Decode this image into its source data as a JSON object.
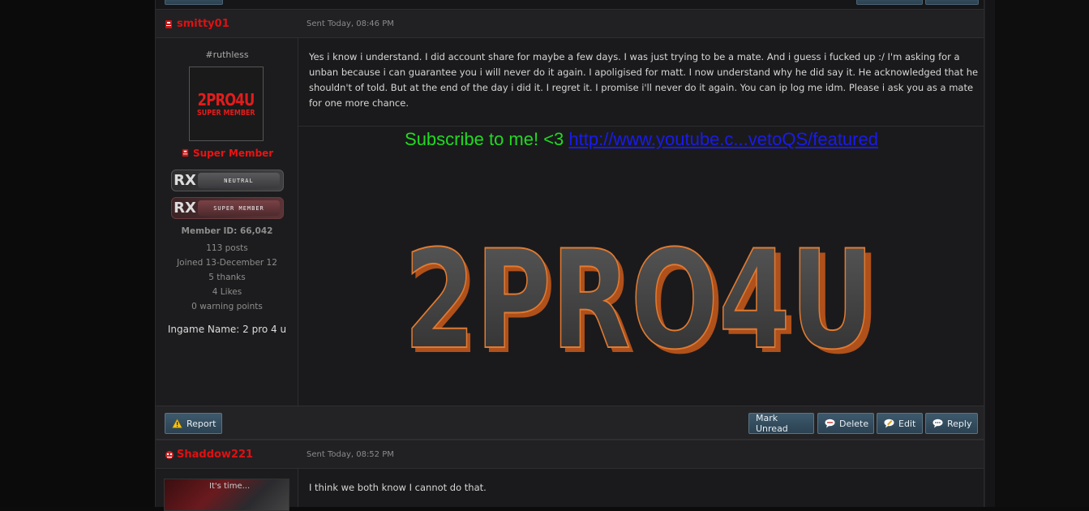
{
  "posts": [
    {
      "author": "smitty01",
      "sent": "Sent Today, 08:46 PM",
      "user_title": "#ruthless",
      "avatar_text": "2PRO4U",
      "avatar_subtext": "SUPER MEMBER",
      "group": "Super Member",
      "ranks": [
        {
          "tag": "RX",
          "label": "NEUTRAL"
        },
        {
          "tag": "RX",
          "label": "SUPER MEMBER"
        }
      ],
      "member_id": "Member ID: 66,042",
      "stats": [
        "113 posts",
        "Joined 13-December 12",
        "5 thanks",
        "4 Likes",
        "0 warning points"
      ],
      "ingame": "Ingame Name: 2 pro 4 u",
      "message": "Yes i know i understand. I did account share for maybe a few days. I was just trying to be a mate. And i guess i fucked up :/ I'm asking for a unban because i can guarantee you i will never do it again. I apoligised for matt. I now understand why he did say it. He acknowledged that he shouldn't of told. But at the end of the day i did it. I regret it. I promise i'll never do it again. You can ip log me idm. Please i ask you as a mate for one more chance.",
      "signature": {
        "text": "Subscribe to me! <3",
        "link": "http://www.youtube.c...vetoQS/featured",
        "banner_text": "2PRO4U"
      }
    },
    {
      "author": "Shaddow221",
      "sent": "Sent Today, 08:52 PM",
      "avatar_caption": "It's time...",
      "message": "I think we both know I cannot do that."
    }
  ],
  "buttons": {
    "report": "Report",
    "mark_unread": "Mark Unread",
    "delete": "Delete",
    "edit": "Edit",
    "reply": "Reply"
  },
  "colors": {
    "username": "#dd1111",
    "subscribe": "#22d922",
    "link": "#1a1aee",
    "button": "#2f4859"
  }
}
